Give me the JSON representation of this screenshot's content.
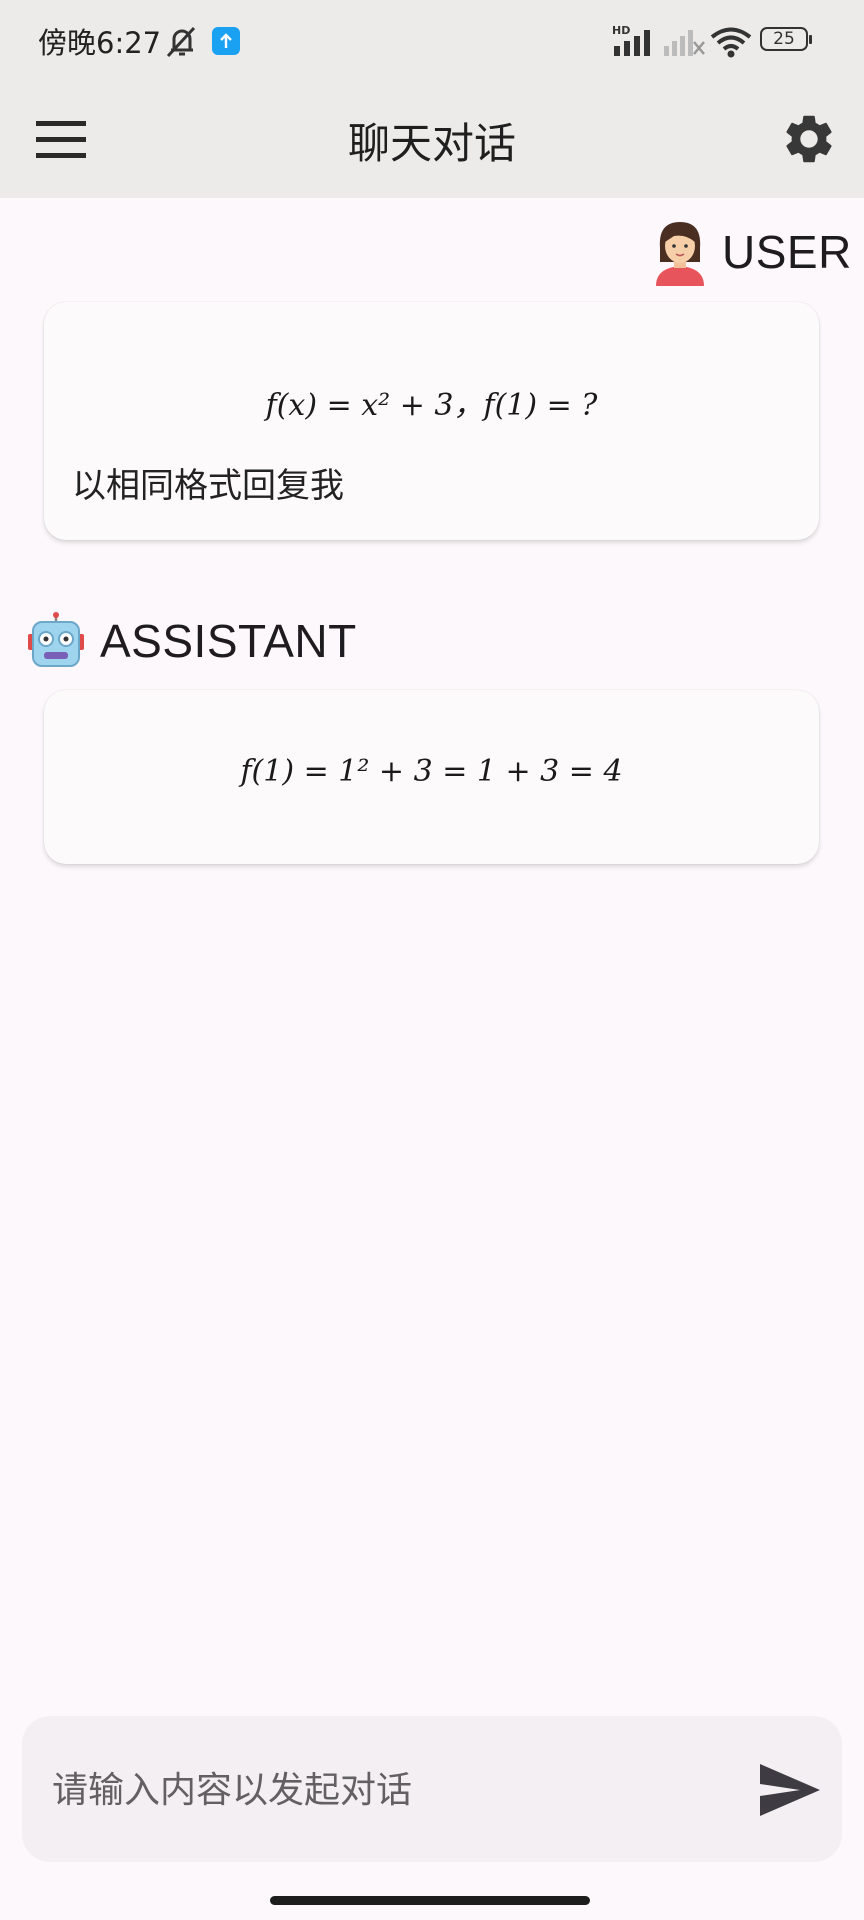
{
  "status_bar": {
    "time": "傍晚6:27",
    "battery": "25",
    "network_badge": "HD",
    "icons": [
      "mute-bell-icon",
      "upload-app-icon",
      "signal-icon",
      "signal-off-icon",
      "wifi-icon",
      "battery-icon"
    ]
  },
  "app_bar": {
    "title": "聊天对话",
    "left_icon": "menu-icon",
    "right_icon": "gear-icon"
  },
  "messages": [
    {
      "role": "USER",
      "avatar_icon": "woman-avatar-icon",
      "math": "f(x) = x² + 3，f(1) = ?",
      "text": "以相同格式回复我"
    },
    {
      "role": "ASSISTANT",
      "avatar_icon": "robot-avatar-icon",
      "math": "f(1) = 1² + 3 = 1 + 3 = 4"
    }
  ],
  "composer": {
    "placeholder": "请输入内容以发起对话",
    "send_icon": "send-icon"
  },
  "colors": {
    "app_bar_bg": "#edebea",
    "page_bg": "#fcf8fb",
    "card_bg": "#fcfafa",
    "composer_bg": "#f3eff3"
  }
}
